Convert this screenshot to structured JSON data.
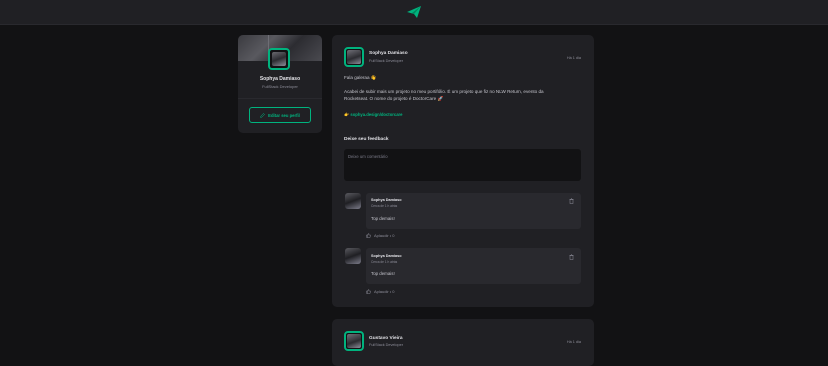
{
  "header": {
    "logo_icon": "ignite-feed-logo-icon"
  },
  "sidebar": {
    "name": "Sophya Damiaso",
    "role": "FullStack Developer",
    "edit_label": "Editar seu perfil"
  },
  "posts": [
    {
      "author": {
        "name": "Sophya Damiaso",
        "role": "FullStack Developer"
      },
      "time": "Há 1 dia",
      "content": [
        "Fala galeraa 👋",
        "Acabei de subir mais um projeto no meu portifólio. É um projeto que fiz no NLW Return, evento da",
        "Rocketseat. O nome do projeto é DoctorCare 🚀",
        "👉 sophya.design/doctorcare"
      ],
      "feedback": {
        "title": "Deixe seu feedback",
        "placeholder": "Deixe um comentário"
      },
      "comments": [
        {
          "name": "Sophya Damiaso",
          "time": "Cerca de 1 h atrás",
          "text": "Top demais!",
          "applaud": "Aplaudir • 0"
        },
        {
          "name": "Sophya Damiaso",
          "time": "Cerca de 1 h atrás",
          "text": "Top demais!",
          "applaud": "Aplaudir • 0"
        }
      ]
    },
    {
      "author": {
        "name": "Gustavo Vieira",
        "role": "FullStack Developer"
      },
      "time": "Há 1 dia"
    }
  ],
  "colors": {
    "accent": "#00b37e",
    "background": "#121214",
    "card": "#202024",
    "comment": "#29292e"
  }
}
